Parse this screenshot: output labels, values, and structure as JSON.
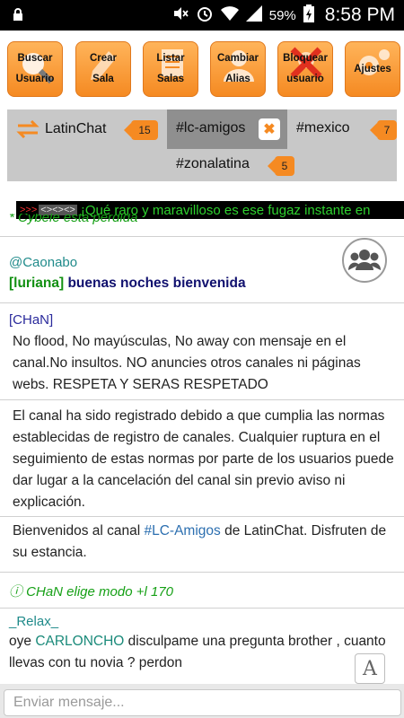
{
  "statusbar": {
    "battery_pct": "59%",
    "time": "8:58 PM"
  },
  "toolbar": [
    {
      "label": "Buscar\nUsuario",
      "icon": "magnifier-icon"
    },
    {
      "label": "Crear\nSala",
      "icon": "pen-icon"
    },
    {
      "label": "Listar\nSalas",
      "icon": "list-icon"
    },
    {
      "label": "Cambiar\nAlias",
      "icon": "user-icon"
    },
    {
      "label": "Bloquear\nusuario",
      "icon": "block-icon"
    },
    {
      "label": "Ajustes",
      "icon": "gear-icon"
    }
  ],
  "tabs": {
    "main": {
      "name": "LatinChat",
      "badge": "15"
    },
    "active": {
      "name": "#lc-amigos",
      "close": "✖"
    },
    "mexico": {
      "name": "#mexico",
      "badge": "7"
    },
    "latina": {
      "name": "#zonalatina",
      "badge": "5"
    }
  },
  "marquee": {
    "arrows_red": ">>>",
    "arrows_gray": "<><><>",
    "text": "¡Qué raro y maravilloso es ese fugaz instante en"
  },
  "chat": {
    "top_system": "* Cybele está perdida",
    "m1_nick": "@Caonabo",
    "m1_bracket": "[luriana]",
    "m1_text": " buenas noches bienvenida",
    "m2_nick": "[CHaN]",
    "m2_text": "No flood, No mayúsculas, No away con mensaje en el canal.No insultos. NO anuncies otros canales ni páginas webs. RESPETA Y SERAS RESPETADO",
    "m3_text": "El canal ha sido registrado debido a que cumplia las normas establecidas de registro de canales. Cualquier ruptura en el seguimiento de estas normas por parte de los usuarios puede dar lugar a la cancelación del canal sin previo aviso ni explicación.",
    "m4_pre": "Bienvenidos al canal ",
    "m4_link": "#LC-Amigos",
    "m4_post": " de LatinChat. Disfruten de su estancia.",
    "m5_system": "ⓘ CHaN elige modo +l 170",
    "m6_nick": "_Relax_",
    "m6_pre": "oye ",
    "m6_mention": "CARLONCHO",
    "m6_post": " disculpame una pregunta brother , cuanto llevas con tu novia ? perdon"
  },
  "font_button": "A",
  "input": {
    "placeholder": "Enviar mensaje..."
  },
  "colors": {
    "accent": "#f58a22",
    "tab_bg": "#c8c8c8",
    "active_tab": "#8f8f8f",
    "marquee_text": "#2ed12e"
  }
}
